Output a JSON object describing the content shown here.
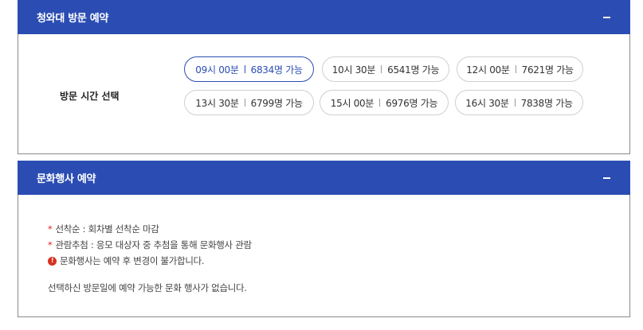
{
  "visit_section": {
    "title": "청와대 방문 예약",
    "collapse_icon": "minus-icon",
    "time_label": "방문 시간 선택",
    "slots": [
      {
        "time": "09시 00분",
        "availability": "6834명 가능",
        "selected": true
      },
      {
        "time": "10시 30분",
        "availability": "6541명 가능",
        "selected": false
      },
      {
        "time": "12시 00분",
        "availability": "7621명 가능",
        "selected": false
      },
      {
        "time": "13시 30분",
        "availability": "6799명 가능",
        "selected": false
      },
      {
        "time": "15시 00분",
        "availability": "6976명 가능",
        "selected": false
      },
      {
        "time": "16시 30분",
        "availability": "7838명 가능",
        "selected": false
      }
    ]
  },
  "event_section": {
    "title": "문화행사 예약",
    "collapse_icon": "minus-icon",
    "notes": [
      {
        "marker": "*",
        "text": "선착순 : 회차별 선착순 마감"
      },
      {
        "marker": "*",
        "text": "관람추첨 : 응모 대상자 중 추첨을 통해 문화행사 관람"
      },
      {
        "marker": "!",
        "text": "문화행사는 예약 후 변경이 불가합니다."
      }
    ],
    "empty_message": "선택하신 방문일에 예약 가능한 문화 행사가 없습니다."
  },
  "colors": {
    "header_bg": "#2b4db3",
    "selected_accent": "#2b4db3",
    "note_star": "#dd2222",
    "info_icon": "#d6321f"
  }
}
